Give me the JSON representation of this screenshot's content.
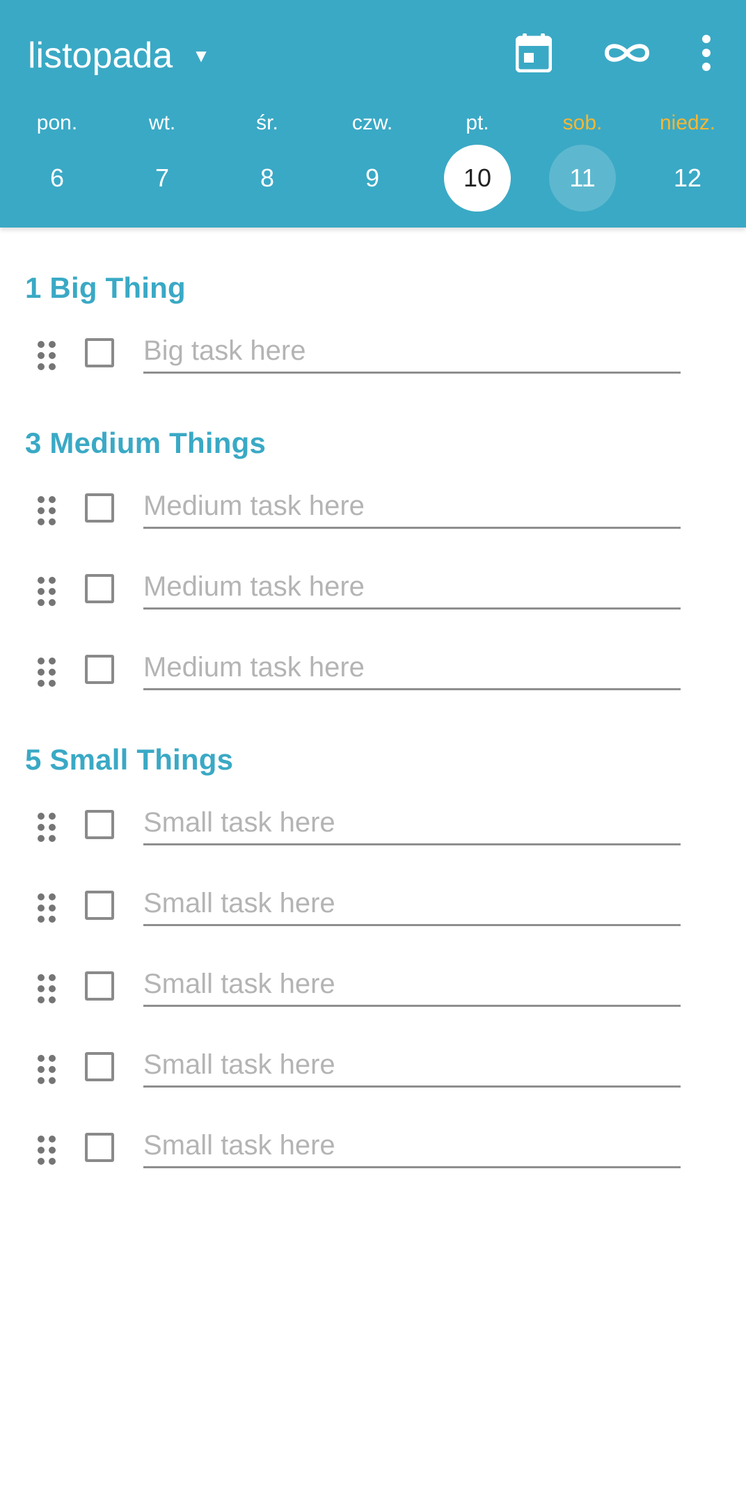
{
  "header": {
    "month": "listopada",
    "caret": "▼",
    "icons": [
      "calendar-icon",
      "infinity-icon",
      "more-vert-icon"
    ],
    "background_color": "#3aa9c5",
    "weekend_color": "#f7b731"
  },
  "week": {
    "days": [
      {
        "name": "pon.",
        "number": "6"
      },
      {
        "name": "wt.",
        "number": "7"
      },
      {
        "name": "śr.",
        "number": "8"
      },
      {
        "name": "czw.",
        "number": "9"
      },
      {
        "name": "pt.",
        "number": "10",
        "selected": true
      },
      {
        "name": "sob.",
        "number": "11",
        "weekend": true
      },
      {
        "name": "niedz.",
        "number": "12",
        "weekend": true
      }
    ]
  },
  "sections": [
    {
      "title": "1 Big Thing",
      "tasks": [
        {
          "value": "",
          "placeholder": "Big task here",
          "checked": false
        }
      ]
    },
    {
      "title": "3 Medium Things",
      "tasks": [
        {
          "value": "",
          "placeholder": "Medium task here",
          "checked": false
        },
        {
          "value": "",
          "placeholder": "Medium task here",
          "checked": false
        },
        {
          "value": "",
          "placeholder": "Medium task here",
          "checked": false
        }
      ]
    },
    {
      "title": "5 Small Things",
      "tasks": [
        {
          "value": "",
          "placeholder": "Small task here",
          "checked": false
        },
        {
          "value": "",
          "placeholder": "Small task here",
          "checked": false
        },
        {
          "value": "",
          "placeholder": "Small task here",
          "checked": false
        },
        {
          "value": "",
          "placeholder": "Small task here",
          "checked": false
        },
        {
          "value": "",
          "placeholder": "Small task here",
          "checked": false
        }
      ]
    }
  ]
}
